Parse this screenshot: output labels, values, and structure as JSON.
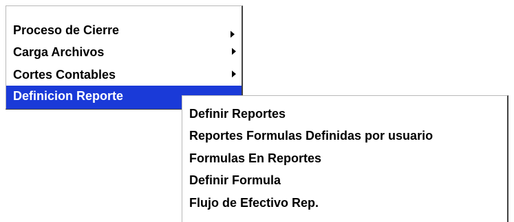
{
  "main_menu": {
    "items": [
      {
        "label": "Proceso de Cierre",
        "has_submenu": true
      },
      {
        "label": "Carga Archivos",
        "has_submenu": true
      },
      {
        "label": "Cortes Contables",
        "has_submenu": true
      },
      {
        "label": "Definicion Reporte",
        "has_submenu": true,
        "highlighted": true
      }
    ]
  },
  "sub_menu": {
    "items": [
      {
        "label": "Definir Reportes"
      },
      {
        "label": "Reportes Formulas Definidas por usuario"
      },
      {
        "label": "Formulas En Reportes"
      },
      {
        "label": "Definir Formula"
      },
      {
        "label": "Flujo de Efectivo Rep."
      }
    ]
  },
  "colors": {
    "highlight": "#1a3ad8",
    "highlight_text": "#ffffff"
  }
}
